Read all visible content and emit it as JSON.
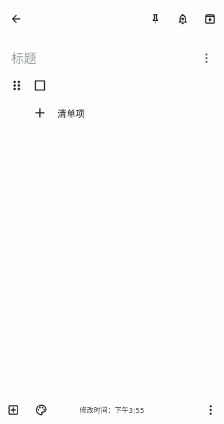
{
  "toolbar": {
    "back_icon": "arrow-left-icon",
    "pin_icon": "pin-icon",
    "reminder_icon": "bell-plus-icon",
    "archive_icon": "archive-icon"
  },
  "note": {
    "title_placeholder": "标题",
    "more_icon": "more-vert-icon"
  },
  "checklist": {
    "items": [
      {
        "checked": false,
        "text": ""
      }
    ],
    "add_item_label": "清单项"
  },
  "bottom": {
    "add_icon": "add-box-icon",
    "palette_icon": "palette-icon",
    "modified_text": "修改时间：下午3:55",
    "more_icon": "more-vert-icon"
  },
  "colors": {
    "background": "#fdfefd",
    "icon": "#202124",
    "placeholder": "#9aa0a6"
  }
}
